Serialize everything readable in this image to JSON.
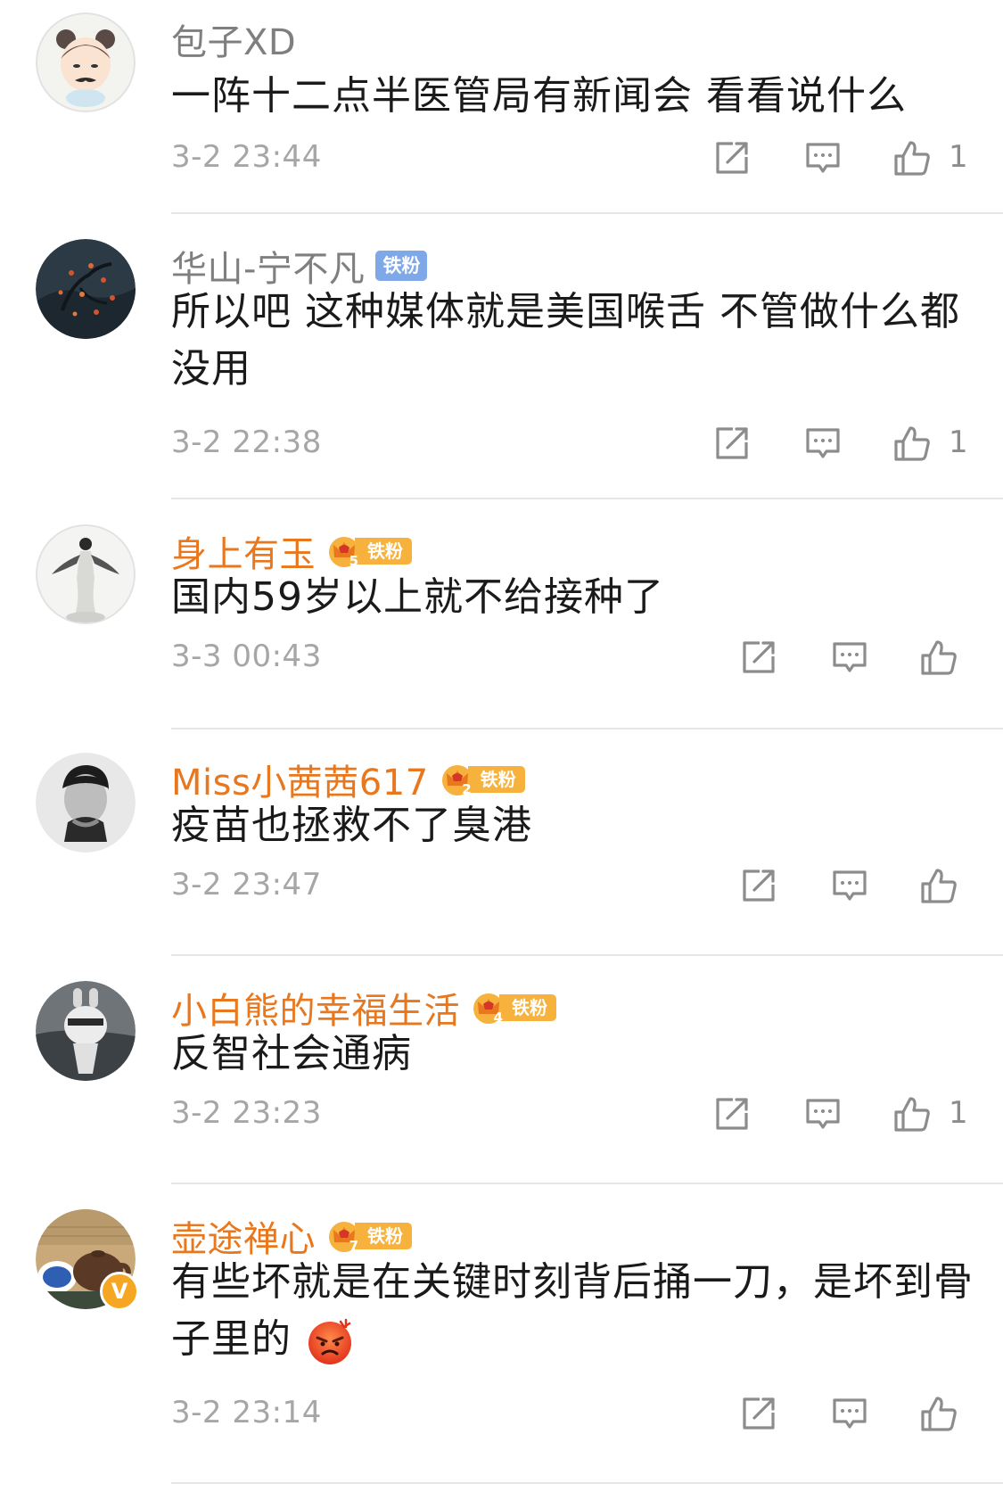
{
  "comments": [
    {
      "user": "包子XD",
      "vip": false,
      "badge": "",
      "level": "",
      "text": "一阵十二点半医管局有新闻会 看看说什么",
      "time": "3-2 23:44",
      "likes": "1",
      "avatar_icon": "cartoon-girl-avatar"
    },
    {
      "user": "华山-宁不凡",
      "vip": false,
      "badge": "铁粉",
      "level": "",
      "text": "所以吧 这种媒体就是美国喉舌  不管做什么都没用",
      "time": "3-2 22:38",
      "likes": "1",
      "avatar_icon": "night-tree-avatar"
    },
    {
      "user": "身上有玉",
      "vip": true,
      "badge": "铁粉",
      "level": "5",
      "text": "国内59岁以上就不给接种了",
      "time": "3-3 00:43",
      "likes": "",
      "avatar_icon": "dancer-avatar"
    },
    {
      "user": "Miss小茜茜617",
      "vip": true,
      "badge": "铁粉",
      "level": "2",
      "text": "疫苗也拯救不了臭港",
      "time": "3-2 23:47",
      "likes": "",
      "avatar_icon": "portrait-avatar"
    },
    {
      "user": "小白熊的幸福生活",
      "vip": true,
      "badge": "铁粉",
      "level": "4",
      "text": "反智社会通病",
      "time": "3-2 23:23",
      "likes": "1",
      "avatar_icon": "bear-avatar"
    },
    {
      "user": "壶途禅心",
      "vip": true,
      "badge": "铁粉",
      "level": "7",
      "text": "有些坏就是在关键时刻背后捅一刀，是坏到骨子里的",
      "time": "3-2 23:14",
      "likes": "",
      "avatar_icon": "teapot-avatar",
      "verified": "V",
      "emoji": "angry-face-emoji"
    }
  ],
  "icons": {
    "repost": "repost-icon",
    "comment": "comment-icon",
    "like": "like-icon"
  },
  "colors": {
    "vip_name": "#e8771e",
    "normal_name": "#7f7f7f",
    "fan_badge_blue": "#7fa8e8",
    "fan_badge_gold": "#f6b23c",
    "meta_gray": "#a6a6a6",
    "divider": "#e6e6e6"
  }
}
